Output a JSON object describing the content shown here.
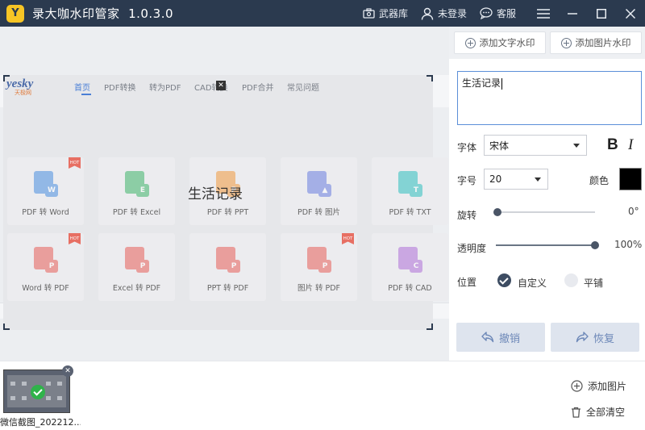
{
  "app": {
    "logo_glyph": "Y",
    "title": "录大咖水印管家",
    "version": "1.0.3.0"
  },
  "titlebar": {
    "arsenal_label": "武器库",
    "login_label": "未登录",
    "support_label": "客服"
  },
  "preview": {
    "site_logo": "yesky",
    "site_logo_sub": "天极网",
    "nav": [
      "首页",
      "PDF转换",
      "转为PDF",
      "CAD转换",
      "PDF合并",
      "常见问题"
    ],
    "hot_label": "HOT",
    "tiles_row1": [
      {
        "label": "PDF 转 Word",
        "badge": "W",
        "color": "#4a8fe0",
        "hot": true
      },
      {
        "label": "PDF 转 Excel",
        "badge": "E",
        "color": "#3fb56a",
        "hot": false
      },
      {
        "label": "PDF 转 PPT",
        "badge": "P",
        "color": "#f09a3e",
        "hot": false
      },
      {
        "label": "PDF 转 图片",
        "badge": "▲",
        "color": "#6a7fe0",
        "hot": false
      },
      {
        "label": "PDF 转 TXT",
        "badge": "T",
        "color": "#2fbfbf",
        "hot": false
      }
    ],
    "tiles_row2": [
      {
        "label": "Word 转 PDF",
        "badge": "P",
        "color": "#e8605a",
        "hot": true
      },
      {
        "label": "Excel 转 PDF",
        "badge": "P",
        "color": "#e8605a",
        "hot": false
      },
      {
        "label": "PPT 转 PDF",
        "badge": "P",
        "color": "#e8605a",
        "hot": false
      },
      {
        "label": "图片 转 PDF",
        "badge": "P",
        "color": "#e8605a",
        "hot": true
      },
      {
        "label": "PDF 转 CAD",
        "badge": "C",
        "color": "#b070d8",
        "hot": false
      }
    ],
    "watermark_text": "生活记录"
  },
  "panel": {
    "add_text_watermark": "添加文字水印",
    "add_image_watermark": "添加图片水印",
    "text_value": "生活记录",
    "font_label": "字体",
    "font_value": "宋体",
    "bold_label": "B",
    "italic_label": "I",
    "size_label": "字号",
    "size_value": "20",
    "color_label": "颜色",
    "color_value": "#000000",
    "rotate_label": "旋转",
    "rotate_value": "0°",
    "rotate_fraction": 0.0,
    "opacity_label": "透明度",
    "opacity_value": "100%",
    "opacity_fraction": 1.0,
    "position_label": "位置",
    "position_custom": "自定义",
    "position_tile": "平铺",
    "undo_label": "撤销",
    "redo_label": "恢复"
  },
  "bottom": {
    "thumb_label": "微信截图_202212...",
    "add_image": "添加图片",
    "clear_all": "全部清空"
  },
  "colors": {
    "titlebar_bg": "#2b3a4f",
    "accent": "#4a7fd6",
    "check": "#2fb34a"
  }
}
